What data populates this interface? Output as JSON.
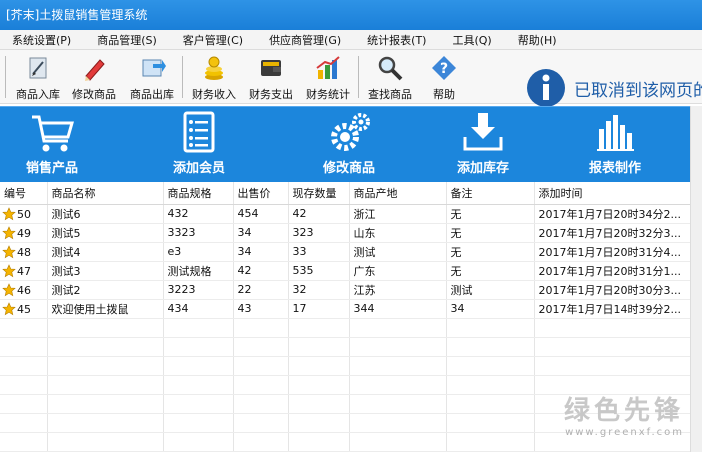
{
  "window": {
    "title": "[芥末]土拨鼠销售管理系统"
  },
  "menu": [
    "系统设置(P)",
    "商品管理(S)",
    "客户管理(C)",
    "供应商管理(G)",
    "统计报表(T)",
    "工具(Q)",
    "帮助(H)"
  ],
  "toolbar": {
    "items": [
      {
        "label": "商品入库",
        "icon": "stock-in-icon"
      },
      {
        "label": "修改商品",
        "icon": "edit-pen-icon"
      },
      {
        "label": "商品出库",
        "icon": "stock-out-icon"
      },
      {
        "label": "财务收入",
        "icon": "coins-icon"
      },
      {
        "label": "财务支出",
        "icon": "wallet-icon"
      },
      {
        "label": "财务统计",
        "icon": "bar-chart-icon"
      },
      {
        "label": "查找商品",
        "icon": "magnifier-icon"
      },
      {
        "label": "帮助",
        "icon": "help-icon"
      }
    ]
  },
  "notice": {
    "text": "已取消到该网页的"
  },
  "actions": [
    {
      "label": "销售产品",
      "icon": "cart-icon"
    },
    {
      "label": "添加会员",
      "icon": "member-list-icon"
    },
    {
      "label": "修改商品",
      "icon": "gears-icon"
    },
    {
      "label": "添加库存",
      "icon": "download-icon"
    },
    {
      "label": "报表制作",
      "icon": "bars-icon"
    }
  ],
  "table": {
    "columns": [
      "编号",
      "商品名称",
      "商品规格",
      "出售价",
      "现存数量",
      "商品产地",
      "备注",
      "添加时间"
    ],
    "rows": [
      [
        "50",
        "测试6",
        "432",
        "454",
        "42",
        "浙江",
        "无",
        "2017年1月7日20时34分2..."
      ],
      [
        "49",
        "测试5",
        "3323",
        "34",
        "323",
        "山东",
        "无",
        "2017年1月7日20时32分3..."
      ],
      [
        "48",
        "测试4",
        "e3",
        "34",
        "33",
        "测试",
        "无",
        "2017年1月7日20时31分4..."
      ],
      [
        "47",
        "测试3",
        "测试规格",
        "42",
        "535",
        "广东",
        "无",
        "2017年1月7日20时31分1..."
      ],
      [
        "46",
        "测试2",
        "3223",
        "22",
        "32",
        "江苏",
        "测试",
        "2017年1月7日20时30分3..."
      ],
      [
        "45",
        "欢迎使用土拨鼠",
        "434",
        "43",
        "17",
        "344",
        "34",
        "2017年1月7日14时39分2..."
      ]
    ]
  },
  "watermark": {
    "main": "绿色先锋",
    "sub": "www.greenxf.com"
  },
  "colors": {
    "accent": "#1c86dc",
    "titlebar": "#1a7fd8",
    "notice": "#1f5ea8",
    "star": "#f5b400"
  }
}
